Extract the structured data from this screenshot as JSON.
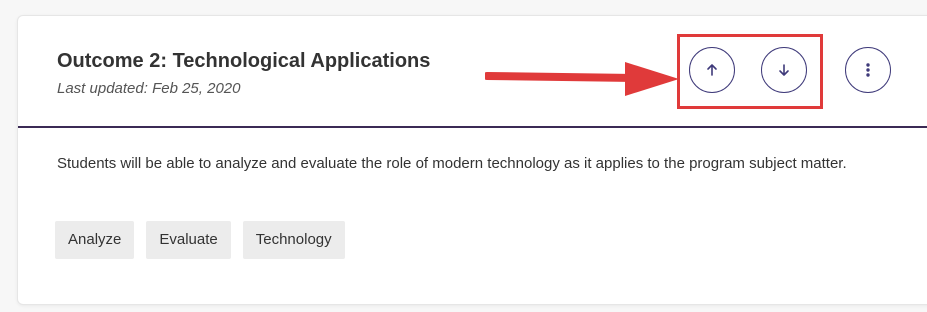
{
  "outcome": {
    "title": "Outcome 2: Technological Applications",
    "last_updated": "Last updated: Feb 25, 2020",
    "description": "Students will be able to analyze and evaluate the role of modern technology as it applies to the program subject matter.",
    "tags": [
      "Analyze",
      "Evaluate",
      "Technology"
    ]
  },
  "actions": {
    "move_up_icon": "arrow-up-icon",
    "move_down_icon": "arrow-down-icon",
    "more_icon": "more-vertical-icon"
  },
  "colors": {
    "accent": "#3f3a7a",
    "divider": "#3b2a55",
    "annotation": "#e03a3a",
    "tag_bg": "#ececec"
  }
}
